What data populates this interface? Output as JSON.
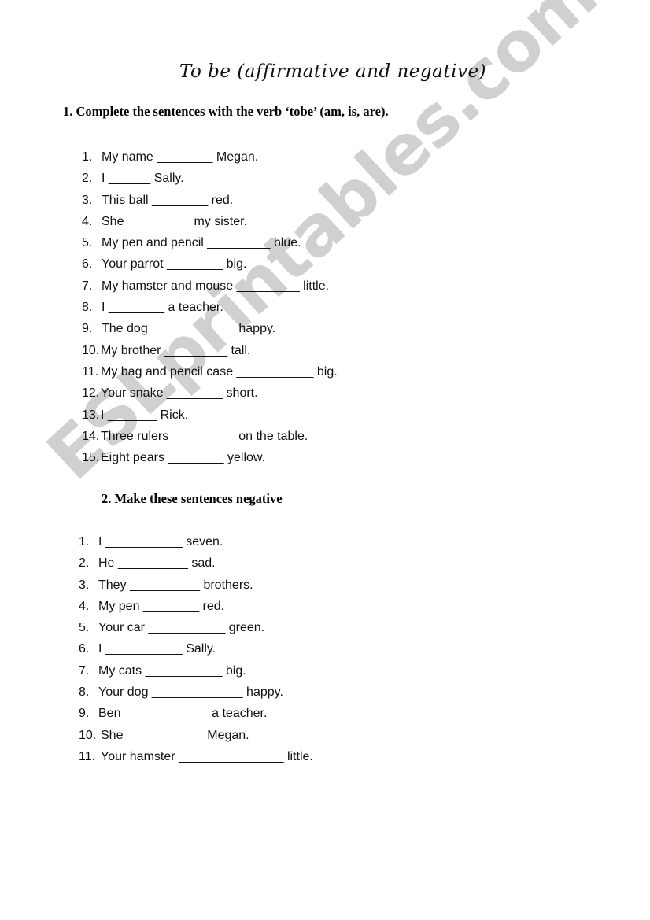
{
  "document": {
    "title": "To be (affirmative and negative)",
    "watermark": "ESLprintables.com",
    "colors": {
      "text": "#111111",
      "watermark": "#c8c8c8",
      "background": "#ffffff"
    }
  },
  "section1": {
    "heading": "1. Complete the sentences with the verb ‘tobe’ (am, is, are).",
    "items": [
      {
        "num": "1.",
        "text": "My name ________ Megan."
      },
      {
        "num": "2.",
        "text": "I ______ Sally."
      },
      {
        "num": "3.",
        "text": "This ball ________ red."
      },
      {
        "num": "4.",
        "text": "She _________ my sister."
      },
      {
        "num": "5.",
        "text": "My pen and pencil _________ blue."
      },
      {
        "num": "6.",
        "text": "Your parrot ________ big."
      },
      {
        "num": "7.",
        "text": "My hamster and mouse _________ little."
      },
      {
        "num": "8.",
        "text": "I ________ a teacher."
      },
      {
        "num": "9.",
        "text": "The dog ____________ happy."
      },
      {
        "num": "10.",
        "text": "My brother _________ tall."
      },
      {
        "num": "11.",
        "text": "My bag and pencil case ___________ big."
      },
      {
        "num": "12.",
        "text": "Your snake ________ short."
      },
      {
        "num": "13.",
        "text": "I _______ Rick."
      },
      {
        "num": "14.",
        "text": "Three rulers _________ on the table."
      },
      {
        "num": "15.",
        "text": "Eight pears ________ yellow."
      }
    ]
  },
  "section2": {
    "heading": "2. Make these sentences negative",
    "items": [
      {
        "num": "1.",
        "text": "I ___________ seven."
      },
      {
        "num": "2.",
        "text": "He __________ sad."
      },
      {
        "num": "3.",
        "text": "They __________ brothers."
      },
      {
        "num": "4.",
        "text": "My pen ________ red."
      },
      {
        "num": "5.",
        "text": "Your car ___________ green."
      },
      {
        "num": "6.",
        "text": "I ___________ Sally."
      },
      {
        "num": "7.",
        "text": "My cats ___________ big."
      },
      {
        "num": "8.",
        "text": "Your dog _____________ happy."
      },
      {
        "num": "9.",
        "text": "Ben ____________ a teacher."
      },
      {
        "num": "10.",
        "text": "She ___________ Megan."
      },
      {
        "num": "11.",
        "text": "Your hamster _______________ little."
      }
    ]
  }
}
